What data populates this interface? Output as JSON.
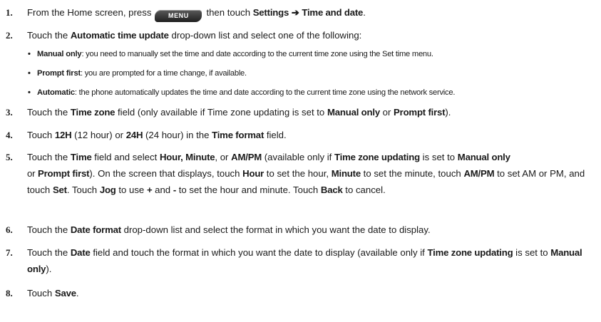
{
  "steps": [
    {
      "number": "1.",
      "before_key": "From the Home screen, press",
      "key_label": "MENU",
      "after_key": "then touch",
      "settings": "Settings",
      "arrow": "➔",
      "time_and_date": "Time and date",
      "end": "."
    },
    {
      "number": "2.",
      "t1": "Touch the",
      "b1": "Automatic time update",
      "t2": "drop-down list and select one of the following:"
    },
    {
      "number": "3.",
      "t1": "Touch the",
      "b1": "Time zone",
      "t2": "field (only available if Time zone updating is set to",
      "b2": "Manual only",
      "t3": "or",
      "b3": "Prompt first",
      "t4": ")."
    },
    {
      "number": "4.",
      "t1": "Touch",
      "b1": "12H",
      "t2": "(12 hour) or",
      "b2": "24H",
      "t3": "(24 hour) in the",
      "b3": "Time format",
      "t4": "field."
    },
    {
      "number": "5.",
      "t1": "Touch the",
      "b1": "Time",
      "t2": "field and select",
      "b2": "Hour, Minute",
      "t3": ", or",
      "b3": "AM/PM",
      "t4": "(available only if",
      "b4": "Time zone updating",
      "t5": "is set to",
      "b5": "Manual only",
      "t6": "or",
      "b6": "Prompt first",
      "t7": "). On the screen that displays, touch",
      "b7": "Hour",
      "t8": "to set the hour,",
      "b8": "Minute",
      "t9": "to set the minute, touch",
      "b9": "AM/PM",
      "t10": "to set AM or PM, and touch",
      "b10": "Set",
      "t11": ". Touch",
      "b11": "Jog",
      "t12": "to use",
      "b12": "+",
      "t13": "and",
      "b13": "-",
      "t14": "to set the hour and minute. Touch",
      "b14": "Back",
      "t15": "to cancel."
    },
    {
      "number": "6.",
      "t1": "Touch the",
      "b1": "Date format",
      "t2": "drop-down list and select the format in which you want the date to display."
    },
    {
      "number": "7.",
      "t1": "Touch the",
      "b1": "Date",
      "t2": "field and touch the format in which you want the date to display (available only if",
      "b2": "Time zone updating",
      "t3": "is set to",
      "b3": "Manual only",
      "t4": ")."
    },
    {
      "number": "8.",
      "t1": "Touch",
      "b1": "Save",
      "t2": "."
    }
  ],
  "options": [
    {
      "bullet": "•",
      "name": "Manual only",
      "desc": ": you need to manually set the time and date according to the current time zone using the Set time menu."
    },
    {
      "bullet": "•",
      "name": "Prompt first",
      "desc": ": you are prompted for a time change, if available."
    },
    {
      "bullet": "•",
      "name": "Automatic",
      "desc": ": the phone automatically updates the time and date according to the current time zone using the network service."
    }
  ]
}
